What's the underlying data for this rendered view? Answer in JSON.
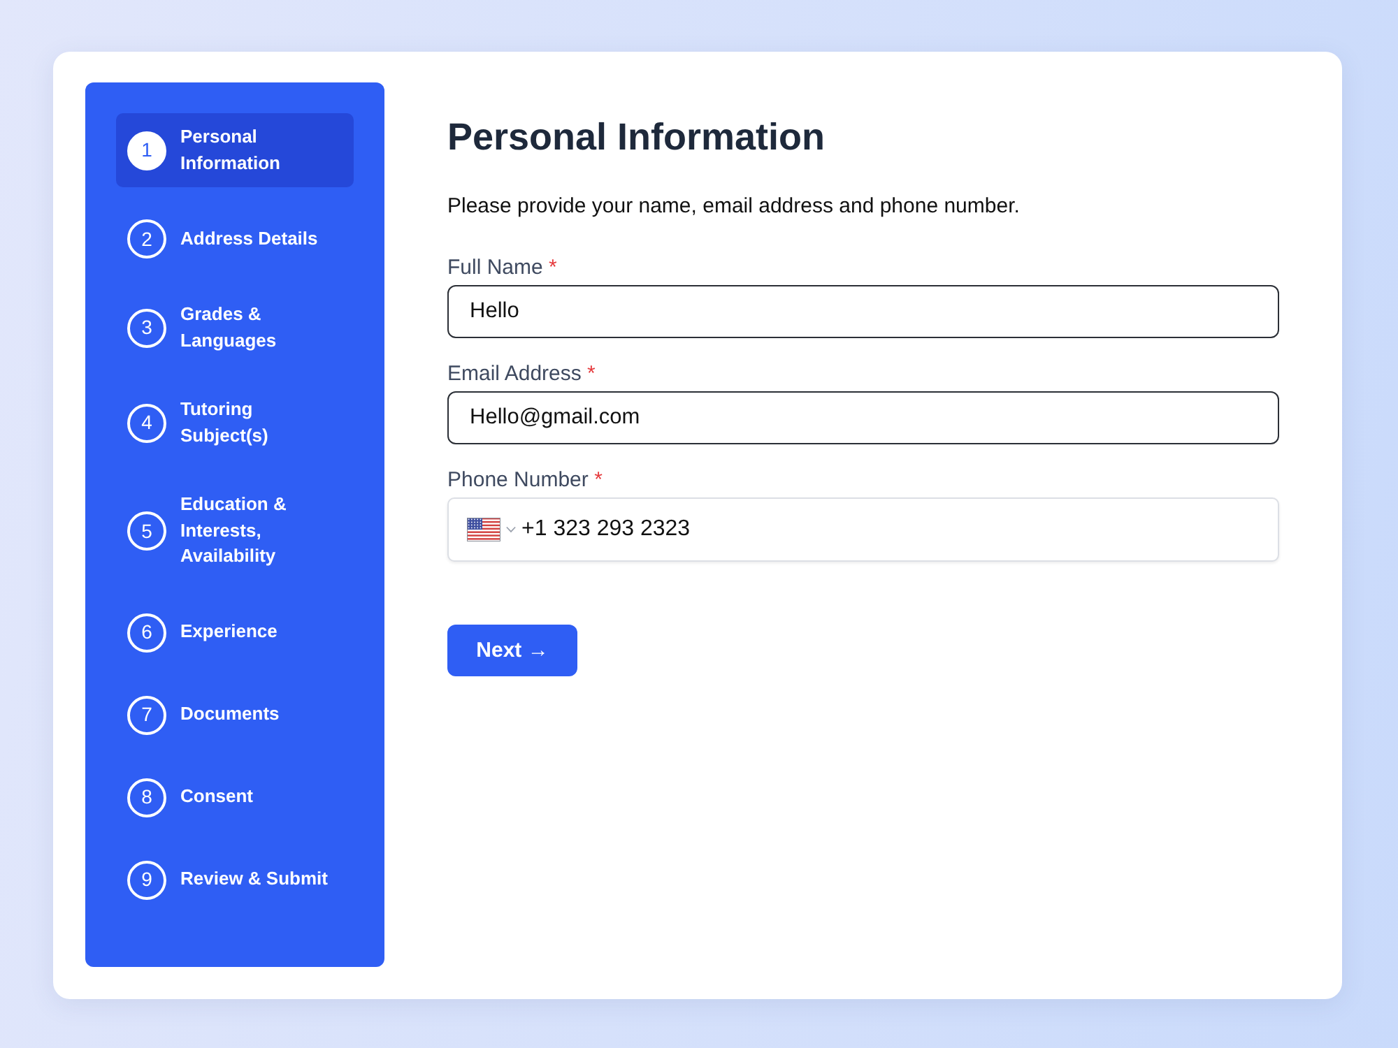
{
  "sidebar": {
    "steps": [
      {
        "number": "1",
        "label": "Personal Information",
        "selected": true
      },
      {
        "number": "2",
        "label": "Address Details",
        "selected": false
      },
      {
        "number": "3",
        "label": "Grades & Languages",
        "selected": false
      },
      {
        "number": "4",
        "label": "Tutoring Subject(s)",
        "selected": false
      },
      {
        "number": "5",
        "label": "Education & Interests, Availability",
        "selected": false
      },
      {
        "number": "6",
        "label": "Experience",
        "selected": false
      },
      {
        "number": "7",
        "label": "Documents",
        "selected": false
      },
      {
        "number": "8",
        "label": "Consent",
        "selected": false
      },
      {
        "number": "9",
        "label": "Review & Submit",
        "selected": false
      }
    ]
  },
  "form": {
    "title": "Personal Information",
    "description": "Please provide your name, email address and phone number.",
    "fields": [
      {
        "kind": "text",
        "label": "Full Name",
        "required_mark": "*",
        "value": "Hello"
      },
      {
        "kind": "text",
        "label": "Email Address",
        "required_mark": "*",
        "value": "Hello@gmail.com"
      },
      {
        "kind": "phone",
        "label": "Phone Number",
        "required_mark": "*",
        "value": "+1 323 293 2323"
      }
    ],
    "next_button": "Next →"
  }
}
